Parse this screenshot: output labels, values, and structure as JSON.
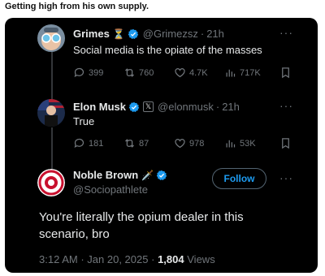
{
  "caption": "Getting high from his own supply.",
  "tweets": [
    {
      "name": "Grimes",
      "badge_emoji": "⏳",
      "handle": "@Grimezsz",
      "dot": "·",
      "time": "21h",
      "text": "Social media is the opiate of the masses",
      "stats": {
        "replies": "399",
        "reposts": "760",
        "likes": "4.7K",
        "views": "717K"
      }
    },
    {
      "name": "Elon Musk",
      "affiliate_badge": "𝕏",
      "handle": "@elonmusk",
      "dot": "·",
      "time": "21h",
      "text": "True",
      "stats": {
        "replies": "181",
        "reposts": "87",
        "likes": "978",
        "views": "53K"
      }
    }
  ],
  "main": {
    "name": "Noble Brown",
    "badge_emoji": "🗡️",
    "handle": "@Sociopathlete",
    "follow_label": "Follow",
    "text": "You're literally the opium dealer in this scenario, bro",
    "time": "3:12 AM",
    "dot1": "·",
    "date": "Jan 20, 2025",
    "dot2": "·",
    "views_count": "1,804",
    "views_label": "Views"
  },
  "more_glyph": "···",
  "colors": {
    "accent": "#1d9bf0",
    "background": "#000000",
    "muted": "#71767b"
  }
}
